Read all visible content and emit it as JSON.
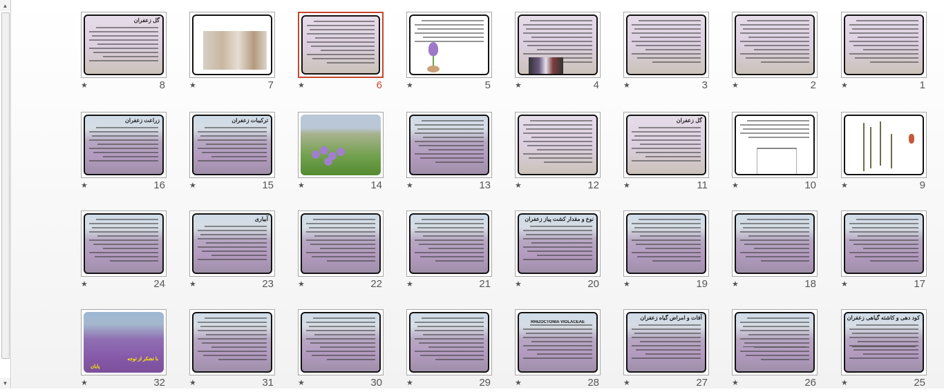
{
  "window": {
    "scrollbar": {
      "up_arrow": "▲",
      "down_arrow": "▼"
    }
  },
  "star_glyph": "★",
  "slides": [
    {
      "number": "1",
      "background": "flower",
      "title": ""
    },
    {
      "number": "2",
      "background": "flower",
      "title": ""
    },
    {
      "number": "3",
      "background": "flower",
      "title": ""
    },
    {
      "number": "4",
      "background": "flower",
      "title": ""
    },
    {
      "number": "5",
      "background": "white",
      "title": ""
    },
    {
      "number": "6",
      "background": "flower",
      "title": "",
      "selected": true
    },
    {
      "number": "7",
      "background": "white",
      "title": ""
    },
    {
      "number": "8",
      "background": "flower",
      "title": "گل زعفران"
    },
    {
      "number": "9",
      "background": "white",
      "title": ""
    },
    {
      "number": "10",
      "background": "white",
      "title": ""
    },
    {
      "number": "11",
      "background": "flower",
      "title": "گل زعفران"
    },
    {
      "number": "12",
      "background": "flower",
      "title": ""
    },
    {
      "number": "13",
      "background": "field",
      "title": ""
    },
    {
      "number": "14",
      "background": "photo",
      "title": ""
    },
    {
      "number": "15",
      "background": "field",
      "title": "ترکیبات زعفران"
    },
    {
      "number": "16",
      "background": "field",
      "title": "زراعت زعفران"
    },
    {
      "number": "17",
      "background": "field",
      "title": ""
    },
    {
      "number": "18",
      "background": "field",
      "title": ""
    },
    {
      "number": "19",
      "background": "field",
      "title": ""
    },
    {
      "number": "20",
      "background": "field",
      "title": "نوع و مقدار کشت پیاز زعفران"
    },
    {
      "number": "21",
      "background": "field",
      "title": ""
    },
    {
      "number": "22",
      "background": "field",
      "title": ""
    },
    {
      "number": "23",
      "background": "field",
      "title": "آبیاری"
    },
    {
      "number": "24",
      "background": "field",
      "title": ""
    },
    {
      "number": "25",
      "background": "field",
      "title": "کود دهی و کاشته گیاهی زعفران"
    },
    {
      "number": "26",
      "background": "field",
      "title": ""
    },
    {
      "number": "27",
      "background": "field",
      "title": "آفات و امراض گیاه زعفران"
    },
    {
      "number": "28",
      "background": "field",
      "title": "RHIZOCTONIA VIOLACEAE"
    },
    {
      "number": "29",
      "background": "field",
      "title": ""
    },
    {
      "number": "30",
      "background": "field",
      "title": ""
    },
    {
      "number": "31",
      "background": "field",
      "title": ""
    },
    {
      "number": "32",
      "background": "field-dark",
      "title": "",
      "caption": "با تشکر از توجه",
      "caption2": "پایان"
    }
  ],
  "colors": {
    "selection": "#c4452a",
    "number": "#555555",
    "caption": "#ffee00"
  }
}
